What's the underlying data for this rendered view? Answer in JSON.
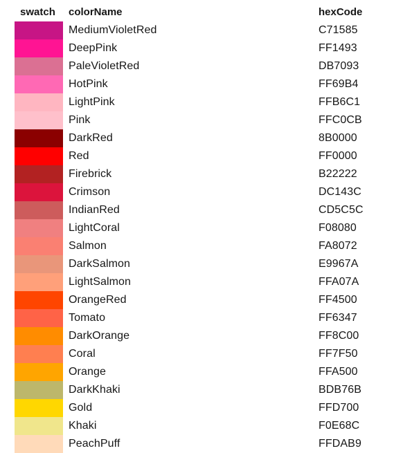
{
  "header": {
    "swatch": "swatch",
    "colorName": "colorName",
    "hexCode": "hexCode"
  },
  "rows": [
    {
      "colorName": "MediumVioletRed",
      "hexCode": "C71585",
      "color": "#C71585"
    },
    {
      "colorName": "DeepPink",
      "hexCode": "FF1493",
      "color": "#FF1493"
    },
    {
      "colorName": "PaleVioletRed",
      "hexCode": "DB7093",
      "color": "#DB7093"
    },
    {
      "colorName": "HotPink",
      "hexCode": "FF69B4",
      "color": "#FF69B4"
    },
    {
      "colorName": "LightPink",
      "hexCode": "FFB6C1",
      "color": "#FFB6C1"
    },
    {
      "colorName": "Pink",
      "hexCode": "FFC0CB",
      "color": "#FFC0CB"
    },
    {
      "colorName": "DarkRed",
      "hexCode": "8B0000",
      "color": "#8B0000"
    },
    {
      "colorName": "Red",
      "hexCode": "FF0000",
      "color": "#FF0000"
    },
    {
      "colorName": "Firebrick",
      "hexCode": "B22222",
      "color": "#B22222"
    },
    {
      "colorName": "Crimson",
      "hexCode": "DC143C",
      "color": "#DC143C"
    },
    {
      "colorName": "IndianRed",
      "hexCode": "CD5C5C",
      "color": "#CD5C5C"
    },
    {
      "colorName": "LightCoral",
      "hexCode": "F08080",
      "color": "#F08080"
    },
    {
      "colorName": "Salmon",
      "hexCode": "FA8072",
      "color": "#FA8072"
    },
    {
      "colorName": "DarkSalmon",
      "hexCode": "E9967A",
      "color": "#E9967A"
    },
    {
      "colorName": "LightSalmon",
      "hexCode": "FFA07A",
      "color": "#FFA07A"
    },
    {
      "colorName": "OrangeRed",
      "hexCode": "FF4500",
      "color": "#FF4500"
    },
    {
      "colorName": "Tomato",
      "hexCode": "FF6347",
      "color": "#FF6347"
    },
    {
      "colorName": "DarkOrange",
      "hexCode": "FF8C00",
      "color": "#FF8C00"
    },
    {
      "colorName": "Coral",
      "hexCode": "FF7F50",
      "color": "#FF7F50"
    },
    {
      "colorName": "Orange",
      "hexCode": "FFA500",
      "color": "#FFA500"
    },
    {
      "colorName": "DarkKhaki",
      "hexCode": "BDB76B",
      "color": "#BDB76B"
    },
    {
      "colorName": "Gold",
      "hexCode": "FFD700",
      "color": "#FFD700"
    },
    {
      "colorName": "Khaki",
      "hexCode": "F0E68C",
      "color": "#F0E68C"
    },
    {
      "colorName": "PeachPuff",
      "hexCode": "FFDAB9",
      "color": "#FFDAB9"
    }
  ]
}
